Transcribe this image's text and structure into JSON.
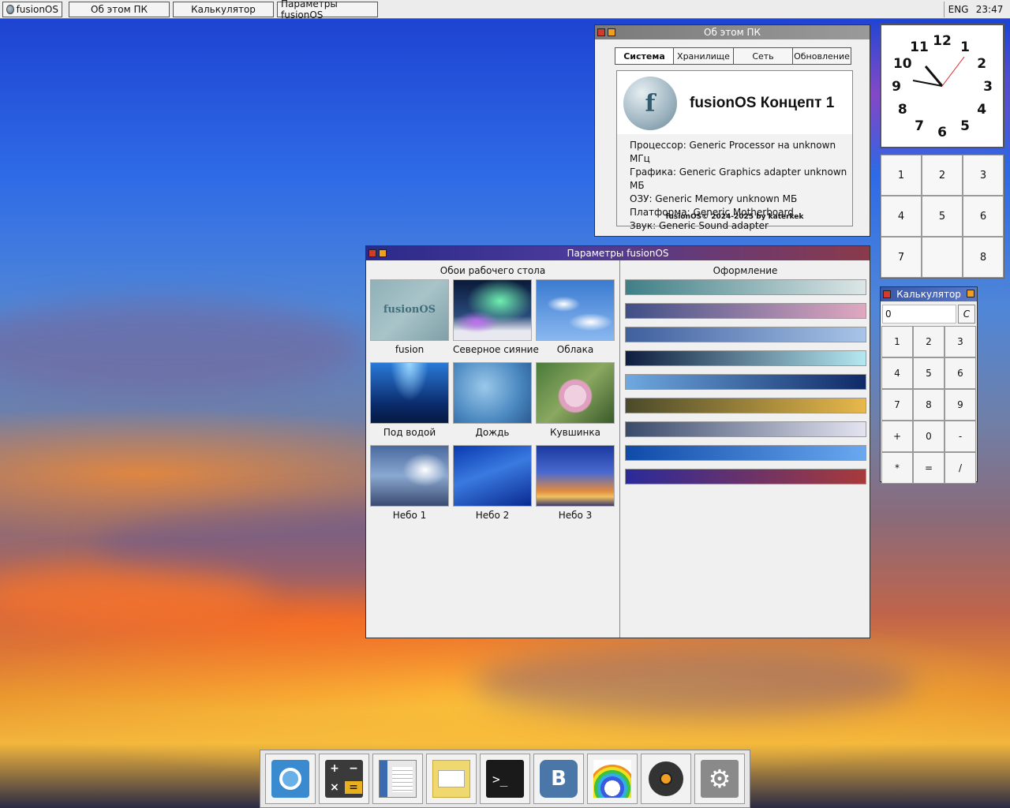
{
  "topbar": {
    "start_label": "fusionOS",
    "tasks": [
      "Об этом ПК",
      "Калькулятор",
      "Параметры fusionOS"
    ],
    "lang": "ENG",
    "time": "23:47"
  },
  "about": {
    "title": "Об этом ПК",
    "tabs": [
      "Система",
      "Хранилище",
      "Сеть",
      "Обновление"
    ],
    "active_tab": "Система",
    "logo_letter": "f",
    "os_name": "fusionOS Концепт 1",
    "specs": [
      "Процессор: Generic Processor на unknown МГц",
      "Графика: Generic Graphics adapter unknown МБ",
      "ОЗУ: Generic Memory unknown МБ",
      "Платформа: Generic Motherboard",
      "Звук:  Generic Sound adapter"
    ],
    "copyright": "fusionOS© 2024-2025 by katerkek"
  },
  "clock": {
    "numbers": [
      "12",
      "1",
      "2",
      "3",
      "4",
      "5",
      "6",
      "7",
      "8",
      "9",
      "10",
      "11"
    ],
    "time": "23:47"
  },
  "numpad": {
    "cells": [
      "1",
      "2",
      "3",
      "4",
      "5",
      "6",
      "7",
      "",
      "8"
    ]
  },
  "calculator": {
    "title": "Калькулятор",
    "display": "0",
    "clear": "C",
    "keys": [
      "1",
      "2",
      "3",
      "4",
      "5",
      "6",
      "7",
      "8",
      "9",
      "+",
      "0",
      "-",
      "*",
      "=",
      "/"
    ]
  },
  "settings": {
    "title": "Параметры fusionOS",
    "wallpapers_title": "Обои рабочего стола",
    "themes_title": "Оформление",
    "wallpapers": [
      {
        "label": "fusion",
        "thumb_text": "fusionOS"
      },
      {
        "label": "Северное сияние"
      },
      {
        "label": "Облака"
      },
      {
        "label": "Под водой"
      },
      {
        "label": "Дождь"
      },
      {
        "label": "Кувшинка"
      },
      {
        "label": "Небо 1"
      },
      {
        "label": "Небо 2"
      },
      {
        "label": "Небо 3"
      }
    ],
    "themes": [
      {
        "from": "#3f7f86",
        "to": "#dde6e6"
      },
      {
        "from": "#3f4f86",
        "to": "#e0a8c0"
      },
      {
        "from": "#3f5f9e",
        "to": "#a8c4e8"
      },
      {
        "from": "#0e1e3e",
        "to": "#b4e8f0"
      },
      {
        "from": "#6fa8e0",
        "to": "#0f2a66"
      },
      {
        "from": "#4a4a2a",
        "to": "#e8b84a"
      },
      {
        "from": "#3a4a6a",
        "to": "#e4e4f0"
      },
      {
        "from": "#0f4aa8",
        "to": "#6aa8f0"
      },
      {
        "from": "#2a2a9a",
        "to": "#a83a3a"
      }
    ]
  },
  "dock": {
    "items": [
      "fusion-start-icon",
      "calculator-icon",
      "text-editor-icon",
      "mail-icon",
      "terminal-icon",
      "vk-icon",
      "paint-icon",
      "music-player-icon",
      "settings-gear-icon"
    ]
  }
}
